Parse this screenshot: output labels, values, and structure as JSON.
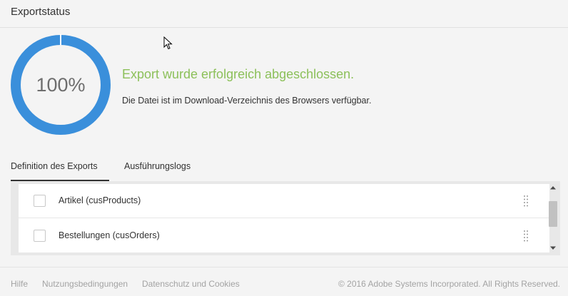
{
  "header": {
    "title": "Exportstatus"
  },
  "progress": {
    "percent_label": "100%",
    "value": 1.0,
    "ring_color": "#3a8fdb",
    "track_color": "#f4f4f4"
  },
  "status": {
    "title": "Export wurde erfolgreich abgeschlossen.",
    "subtitle": "Die Datei ist im Download-Verzeichnis des Browsers verfügbar.",
    "success_color": "#8cc05a"
  },
  "tabs": [
    {
      "label": "Definition des Exports",
      "active": true
    },
    {
      "label": "Ausführungslogs",
      "active": false
    }
  ],
  "list": {
    "items": [
      {
        "label": "Artikel (cusProducts)",
        "checked": false
      },
      {
        "label": "Bestellungen (cusOrders)",
        "checked": false
      }
    ]
  },
  "footer": {
    "links": [
      "Hilfe",
      "Nutzungsbedingungen",
      "Datenschutz und Cookies"
    ],
    "copyright": "© 2016 Adobe Systems Incorporated. All Rights Reserved."
  },
  "icons": {
    "cursor": "mouse-pointer-icon",
    "checkbox": "checkbox-icon",
    "drag": "drag-handle-icon",
    "scroll_up": "chevron-up-icon",
    "scroll_down": "chevron-down-icon"
  }
}
